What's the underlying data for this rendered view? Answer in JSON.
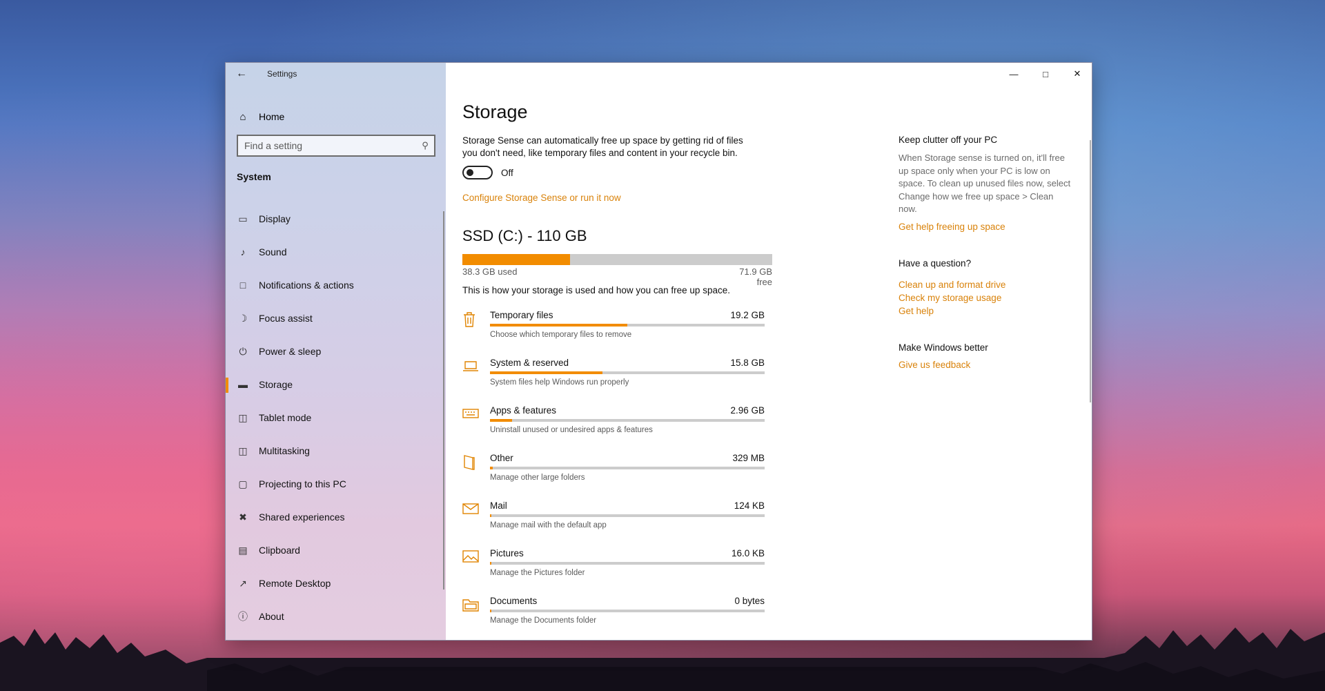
{
  "window": {
    "title": "Settings"
  },
  "sidebar": {
    "home_label": "Home",
    "search_placeholder": "Find a setting",
    "section_title": "System",
    "items": [
      {
        "label": "Display",
        "icon": "monitor-icon"
      },
      {
        "label": "Sound",
        "icon": "speaker-icon"
      },
      {
        "label": "Notifications & actions",
        "icon": "message-icon"
      },
      {
        "label": "Focus assist",
        "icon": "moon-icon"
      },
      {
        "label": "Power & sleep",
        "icon": "power-icon"
      },
      {
        "label": "Storage",
        "icon": "drive-icon",
        "active": true
      },
      {
        "label": "Tablet mode",
        "icon": "tablet-icon"
      },
      {
        "label": "Multitasking",
        "icon": "multitasking-icon"
      },
      {
        "label": "Projecting to this PC",
        "icon": "projector-icon"
      },
      {
        "label": "Shared experiences",
        "icon": "shared-icon"
      },
      {
        "label": "Clipboard",
        "icon": "clipboard-icon"
      },
      {
        "label": "Remote Desktop",
        "icon": "remote-icon"
      },
      {
        "label": "About",
        "icon": "info-icon"
      }
    ]
  },
  "main": {
    "title": "Storage",
    "description": "Storage Sense can automatically free up space by getting rid of files you don't need, like temporary files and content in your recycle bin.",
    "toggle_state": "Off",
    "configure_link": "Configure Storage Sense or run it now",
    "drive": {
      "title": "SSD (C:) - 110 GB",
      "used_label": "38.3 GB used",
      "free_label": "71.9 GB free",
      "used_fraction": 0.348,
      "intro": "This is how your storage is used and how you can free up space."
    },
    "categories": [
      {
        "name": "Temporary files",
        "size": "19.2 GB",
        "desc": "Choose which temporary files to remove",
        "fraction": 0.5,
        "icon": "trash-icon"
      },
      {
        "name": "System & reserved",
        "size": "15.8 GB",
        "desc": "System files help Windows run properly",
        "fraction": 0.41,
        "icon": "laptop-icon"
      },
      {
        "name": "Apps & features",
        "size": "2.96 GB",
        "desc": "Uninstall unused or undesired apps & features",
        "fraction": 0.08,
        "icon": "keyboard-icon"
      },
      {
        "name": "Other",
        "size": "329 MB",
        "desc": "Manage other large folders",
        "fraction": 0.01,
        "icon": "document-icon"
      },
      {
        "name": "Mail",
        "size": "124 KB",
        "desc": "Manage mail with the default app",
        "fraction": 0.0,
        "icon": "mail-icon"
      },
      {
        "name": "Pictures",
        "size": "16.0 KB",
        "desc": "Manage the Pictures folder",
        "fraction": 0.0,
        "icon": "picture-icon"
      },
      {
        "name": "Documents",
        "size": "0 bytes",
        "desc": "Manage the Documents folder",
        "fraction": 0.0,
        "icon": "folder-icon"
      }
    ]
  },
  "aside": {
    "clutter_title": "Keep clutter off your PC",
    "clutter_text": "When Storage sense is turned on, it'll free up space only when your PC is low on space. To clean up unused files now, select Change how we free up space > Clean now.",
    "clutter_link": "Get help freeing up space",
    "question_title": "Have a question?",
    "question_links": [
      "Clean up and format drive",
      "Check my storage usage",
      "Get help"
    ],
    "better_title": "Make Windows better",
    "feedback_link": "Give us feedback"
  },
  "colors": {
    "accent": "#f28c00",
    "link": "#d9820a"
  }
}
